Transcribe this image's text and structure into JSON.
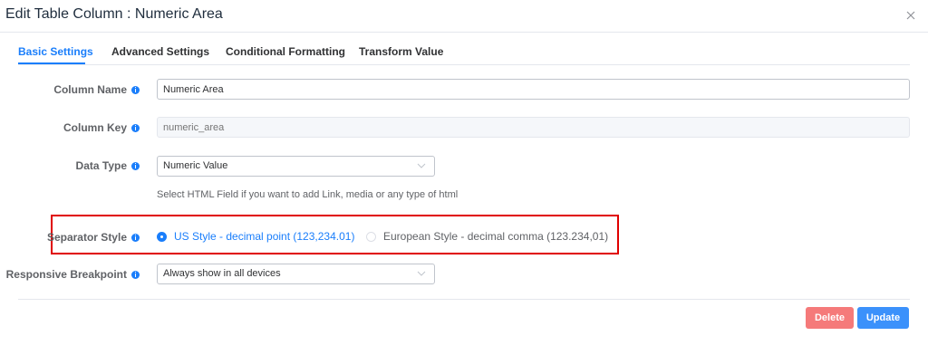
{
  "dialog": {
    "title": "Edit Table Column : Numeric Area"
  },
  "tabs": [
    {
      "label": "Basic Settings",
      "active": true
    },
    {
      "label": "Advanced Settings",
      "active": false
    },
    {
      "label": "Conditional Formatting",
      "active": false
    },
    {
      "label": "Transform Value",
      "active": false
    }
  ],
  "form": {
    "column_name": {
      "label": "Column Name",
      "value": "Numeric Area"
    },
    "column_key": {
      "label": "Column Key",
      "value": "numeric_area"
    },
    "data_type": {
      "label": "Data Type",
      "selected": "Numeric Value",
      "help": "Select HTML Field if you want to add Link, media or any type of html"
    },
    "separator_style": {
      "label": "Separator Style",
      "options": [
        {
          "label": "US Style - decimal point (123,234.01)",
          "checked": true
        },
        {
          "label": "European Style - decimal comma (123.234,01)",
          "checked": false
        }
      ]
    },
    "responsive_breakpoint": {
      "label": "Responsive Breakpoint",
      "selected": "Always show in all devices"
    }
  },
  "footer": {
    "delete_label": "Delete",
    "update_label": "Update"
  },
  "colors": {
    "accent": "#1a7efb",
    "danger": "#f56c6c",
    "highlight": "#e00000"
  }
}
